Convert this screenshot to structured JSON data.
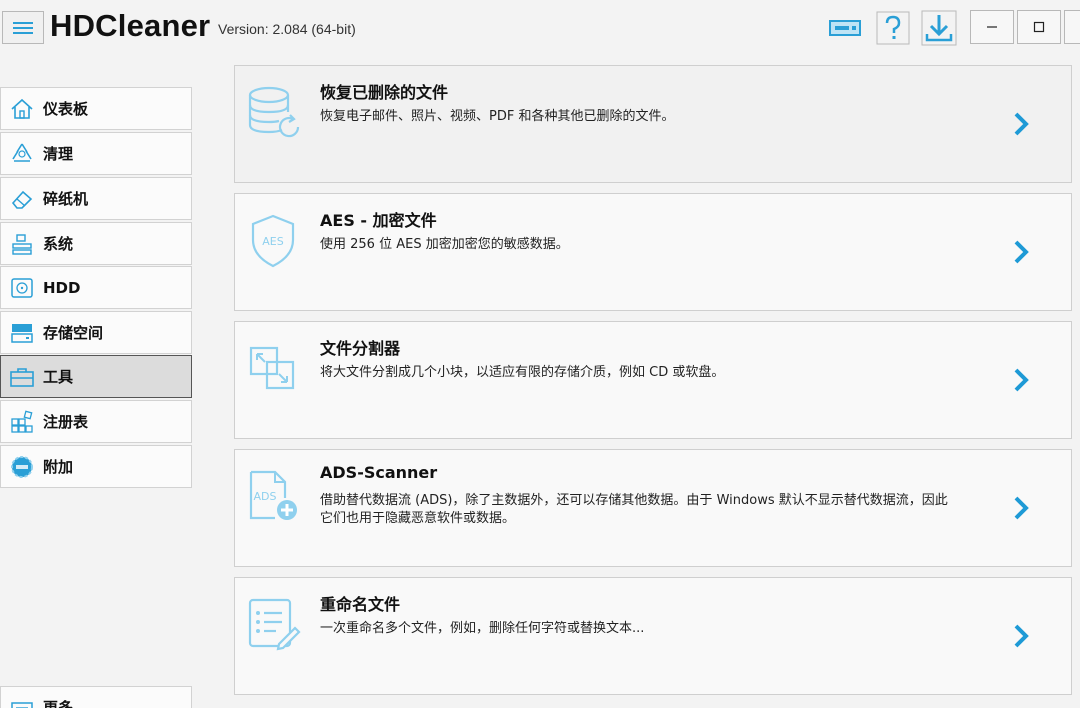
{
  "app": {
    "title": "HDCleaner",
    "version": "Version: 2.084 (64-bit)"
  },
  "titlebar": {
    "icons": [
      "monitor-toggle-icon",
      "help-icon",
      "download-icon"
    ],
    "window_buttons": [
      "minimize-icon",
      "maximize-icon",
      "close-icon"
    ]
  },
  "sidebar": {
    "items": [
      {
        "label": "仪表板",
        "icon": "home-icon"
      },
      {
        "label": "清理",
        "icon": "recycle-icon"
      },
      {
        "label": "碎纸机",
        "icon": "eraser-icon"
      },
      {
        "label": "系统",
        "icon": "system-icon"
      },
      {
        "label": "HDD",
        "icon": "hdd-icon"
      },
      {
        "label": "存储空间",
        "icon": "storage-icon"
      },
      {
        "label": "工具",
        "icon": "toolbox-icon",
        "active": true
      },
      {
        "label": "注册表",
        "icon": "registry-icon"
      },
      {
        "label": "附加",
        "icon": "extra-icon"
      },
      {
        "label": "更多",
        "icon": "more-icon"
      }
    ]
  },
  "tools": [
    {
      "title": "恢复已删除的文件",
      "desc": "恢复电子邮件、照片、视频、PDF 和各种其他已删除的文件。",
      "icon": "database-restore-icon"
    },
    {
      "title": "AES - 加密文件",
      "desc": "使用 256 位 AES 加密加密您的敏感数据。",
      "icon": "aes-shield-icon",
      "icon_text": "AES"
    },
    {
      "title": "文件分割器",
      "desc": "将大文件分割成几个小块，以适应有限的存储介质，例如 CD 或软盘。",
      "icon": "file-split-icon"
    },
    {
      "title": "ADS-Scanner",
      "desc": "借助替代数据流 (ADS)，除了主数据外，还可以存储其他数据。由于 Windows 默认不显示替代数据流，因此它们也用于隐藏恶意软件或数据。",
      "icon": "ads-file-add-icon",
      "icon_text": "ADS"
    },
    {
      "title": "重命名文件",
      "desc": "一次重命名多个文件，例如，删除任何字符或替换文本...",
      "icon": "rename-list-icon"
    }
  ],
  "colors": {
    "accent": "#2a9fd6",
    "icon_light": "#8fd0ee",
    "chevron": "#1e9ad6"
  }
}
